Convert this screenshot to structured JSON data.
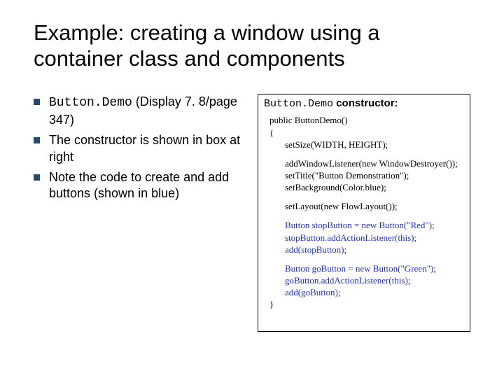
{
  "title": "Example: creating a window using a container class and components",
  "bullets": [
    {
      "mono_prefix": "Button.Demo",
      "rest": " (Display 7. 8/page 347)"
    },
    {
      "text": "The constructor is shown in box at right"
    },
    {
      "text": "Note the code to create and add buttons (shown in blue)"
    }
  ],
  "codebox": {
    "header_mono": "Button.Demo",
    "header_bold": " constructor:",
    "lines": [
      {
        "indent": 0,
        "text": "public ButtonDemo()",
        "blue": false
      },
      {
        "indent": 0,
        "text": "{",
        "blue": false
      },
      {
        "indent": 1,
        "text": "setSize(WIDTH, HEIGHT);",
        "blue": false
      },
      {
        "blank": true
      },
      {
        "indent": 1,
        "text": "addWindowListener(new WindowDestroyer());",
        "blue": false
      },
      {
        "indent": 1,
        "text": "setTitle(\"Button Demonstration\");",
        "blue": false
      },
      {
        "indent": 1,
        "text": "setBackground(Color.blue);",
        "blue": false
      },
      {
        "blank": true
      },
      {
        "indent": 1,
        "text": "setLayout(new FlowLayout());",
        "blue": false
      },
      {
        "blank": true
      },
      {
        "indent": 1,
        "text": "Button stopButton = new Button(\"Red\");",
        "blue": true
      },
      {
        "indent": 1,
        "text": "stopButton.addActionListener(this);",
        "blue": true
      },
      {
        "indent": 1,
        "text": "add(stopButton);",
        "blue": true
      },
      {
        "blank": true
      },
      {
        "indent": 1,
        "text": "Button goButton = new Button(\"Green\");",
        "blue": true
      },
      {
        "indent": 1,
        "text": "goButton.addActionListener(this);",
        "blue": true
      },
      {
        "indent": 1,
        "text": "add(goButton);",
        "blue": true
      },
      {
        "indent": 0,
        "text": "}",
        "blue": false
      }
    ]
  }
}
